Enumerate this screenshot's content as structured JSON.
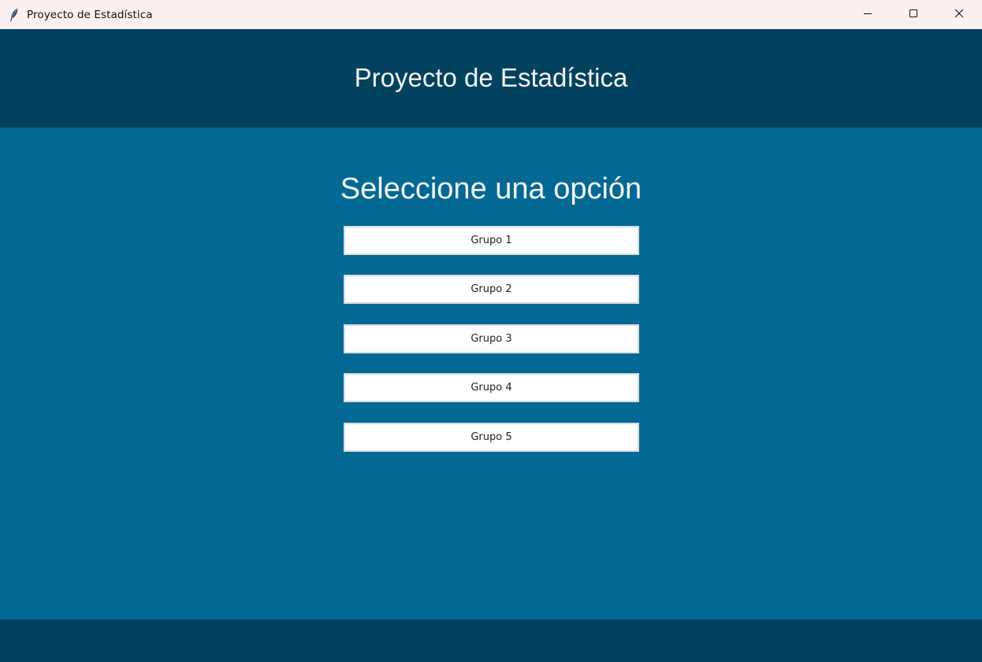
{
  "window": {
    "title": "Proyecto de Estadística",
    "icon": "feather-icon",
    "controls": [
      "minimize-icon",
      "maximize-icon",
      "close-icon"
    ]
  },
  "header": {
    "title": "Proyecto de Estadística"
  },
  "main": {
    "prompt": "Seleccione una opción",
    "buttons": [
      {
        "label": "Grupo 1"
      },
      {
        "label": "Grupo 2"
      },
      {
        "label": "Grupo 3"
      },
      {
        "label": "Grupo 4"
      },
      {
        "label": "Grupo 5"
      }
    ]
  },
  "colors": {
    "titlebar": "#faf0ef",
    "header": "#02425e",
    "main": "#036994",
    "footer": "#02425e",
    "button": "#ffffff"
  }
}
